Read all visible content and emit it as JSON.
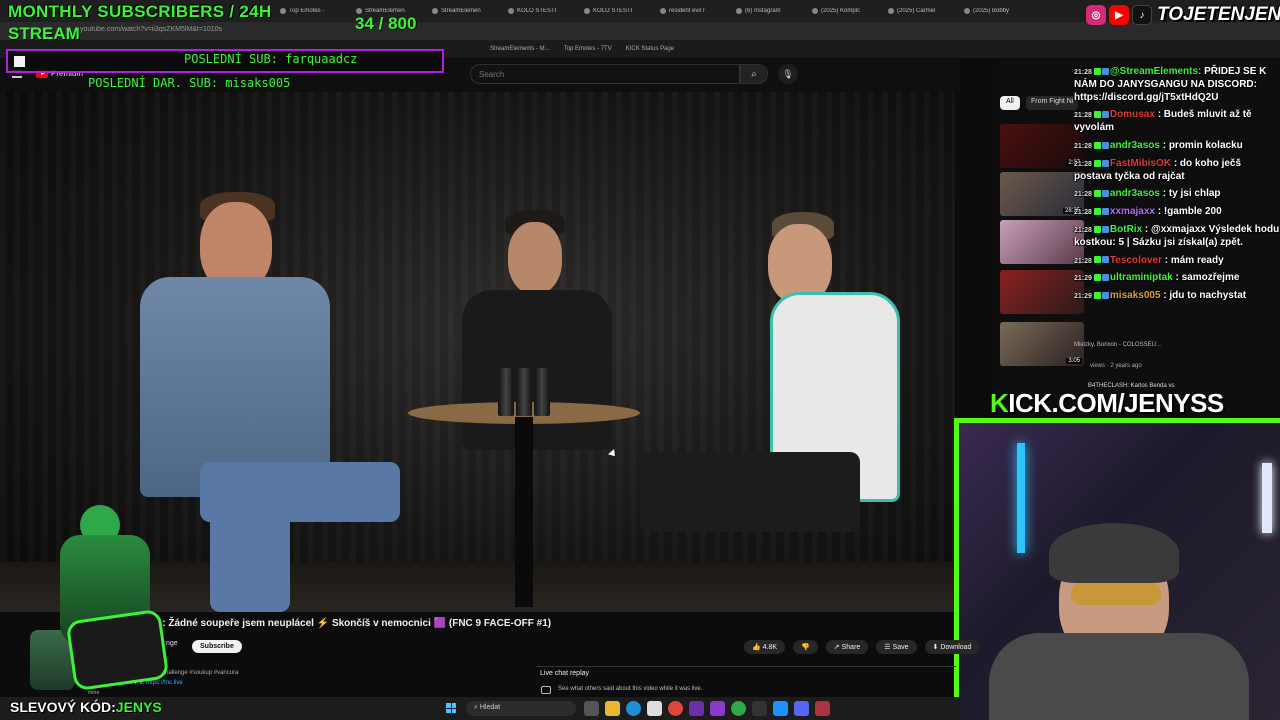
{
  "browser": {
    "tabs": [
      "Top Emotes -",
      "StreamElemen",
      "StreamElemen",
      "KOLO ŠTĚSTÍ",
      "KOLO ŠTĚSTÍ",
      "resident evil r",
      "(6) Instagram",
      "(2025) Komplc",
      "(2025) Carmel",
      "(2025) Bobby"
    ],
    "address": "youtube.com/watch?v=ii3qsZKM5lM&t=1010s",
    "bookmarks": [
      "StreamElements - M...",
      "Top Emotes - 7TV",
      "KICK Status Page"
    ]
  },
  "overlay": {
    "monthly_title": "MONTHLY SUBSCRIBERS / 24H",
    "stream_word": "STREAM",
    "sub_count": "34 / 800",
    "last_sub": "POSLEDNÍ SUB: farquaadcz",
    "last_donation": "POSLEDNÍ DAR. SUB: misaks005",
    "handle": "TOJETENJENYS",
    "kick_url": "KICK.COM/JENYSS",
    "discount": {
      "label": "SLEVOVÝ KÓD:",
      "code": "JENYS"
    }
  },
  "youtube": {
    "premium_label": "Premium",
    "search_placeholder": "Search",
    "video_title": "A: Žádné soupeře jsem neuplácel ⚡ Skončíš v nemocnici 🟪 (FNC 9 FACE-OFF #1)",
    "channel_fragment": "nge",
    "subscribe": "Subscribe",
    "likes": "4.8K",
    "share": "Share",
    "save": "Save",
    "download": "Download",
    "description_meta": "s ago  #fightnightchallenge #soukup #vancura",
    "vstupenky_label": "VSTUPENKY A PPV:",
    "vstupenky_link": "https://fnc.live",
    "more": "more",
    "live_chat_replay": "Live chat replay",
    "live_chat_sub": "See what others said about this video while it was live.",
    "chip_all": "All",
    "chip_from": "From Fight Ni",
    "thumbs": [
      {
        "dur": "2:37"
      },
      {
        "dur": "28:35"
      },
      {
        "dur": ""
      },
      {
        "dur": ""
      },
      {
        "dur": "3:05"
      }
    ],
    "related_caption": "B4THECLASH: Karlos Benda vs",
    "related_sub": "Mielzky, Borixon - COLOSSEU...",
    "related_views": "views · 2 years ago"
  },
  "chat": [
    {
      "time": "21:28",
      "user": "@StreamElements:",
      "msg": "PŘIDEJ SE K NÁM DO JANYSGANGU NA DISCORD: https://discord.gg/jT5xtHdQ2U",
      "user_color": "#3ef23a"
    },
    {
      "time": "21:28",
      "user": "Domusax",
      "msg": ": Budeš mluvit až tě vyvolám",
      "user_color": "#e53935"
    },
    {
      "time": "21:28",
      "user": "andr3asos",
      "msg": ": promin kolacku",
      "user_color": "#3ef23a"
    },
    {
      "time": "21:28",
      "user": "FastMibisOK",
      "msg": ": do koho ječš postava tyčka od rajčat",
      "user_color": "#e53935"
    },
    {
      "time": "21:28",
      "user": "andr3asos",
      "msg": ": ty jsi chlap",
      "user_color": "#3ef23a"
    },
    {
      "time": "21:28",
      "user": "xxmajaxx",
      "msg": ": !gamble 200",
      "user_color": "#b36bff"
    },
    {
      "time": "21:28",
      "user": "BotRix",
      "msg": ": @xxmajaxx Výsledek hodu kostkou: 5 | Sázku jsi získal(a) zpět.",
      "user_color": "#3ef23a"
    },
    {
      "time": "21:28",
      "user": "Tescolover",
      "msg": ": mám ready",
      "user_color": "#e53935"
    },
    {
      "time": "21:29",
      "user": "ultraminiptak",
      "msg": ": samozřejme",
      "user_color": "#3ef23a"
    },
    {
      "time": "21:29",
      "user": "misaks005",
      "msg": ": jdu to nachystat",
      "user_color": "#e0a030"
    }
  ],
  "taskbar": {
    "search": "Hledat"
  },
  "colors": {
    "accent_green": "#3ef23a",
    "kick_green": "#53fc18",
    "sub_border": "#b020e0"
  }
}
